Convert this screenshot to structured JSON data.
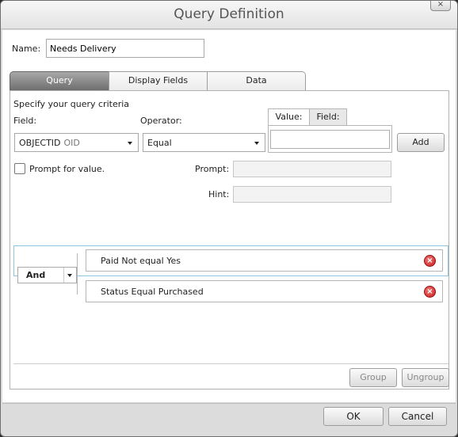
{
  "window": {
    "title": "Query Definition",
    "close_label": "×"
  },
  "name": {
    "label": "Name:",
    "value": "Needs Delivery"
  },
  "tabs": [
    {
      "label": "Query",
      "active": true
    },
    {
      "label": "Display Fields",
      "active": false
    },
    {
      "label": "Data",
      "active": false
    }
  ],
  "query": {
    "instruction": "Specify your query criteria",
    "field_label": "Field:",
    "field_value": "OBJECTID",
    "field_type": "OID",
    "operator_label": "Operator:",
    "operator_value": "Equal",
    "value_tab_label": "Value:",
    "field_tab_label": "Field:",
    "value_input": "",
    "add_label": "Add",
    "prompt_checkbox_label": "Prompt for value.",
    "prompt_checked": false,
    "prompt_label": "Prompt:",
    "prompt_value": "",
    "hint_label": "Hint:",
    "hint_value": "",
    "conjunction": "And",
    "criteria": [
      {
        "text": "Paid Not equal Yes"
      },
      {
        "text": "Status Equal Purchased"
      }
    ],
    "group_label": "Group",
    "ungroup_label": "Ungroup"
  },
  "footer": {
    "ok_label": "OK",
    "cancel_label": "Cancel"
  }
}
